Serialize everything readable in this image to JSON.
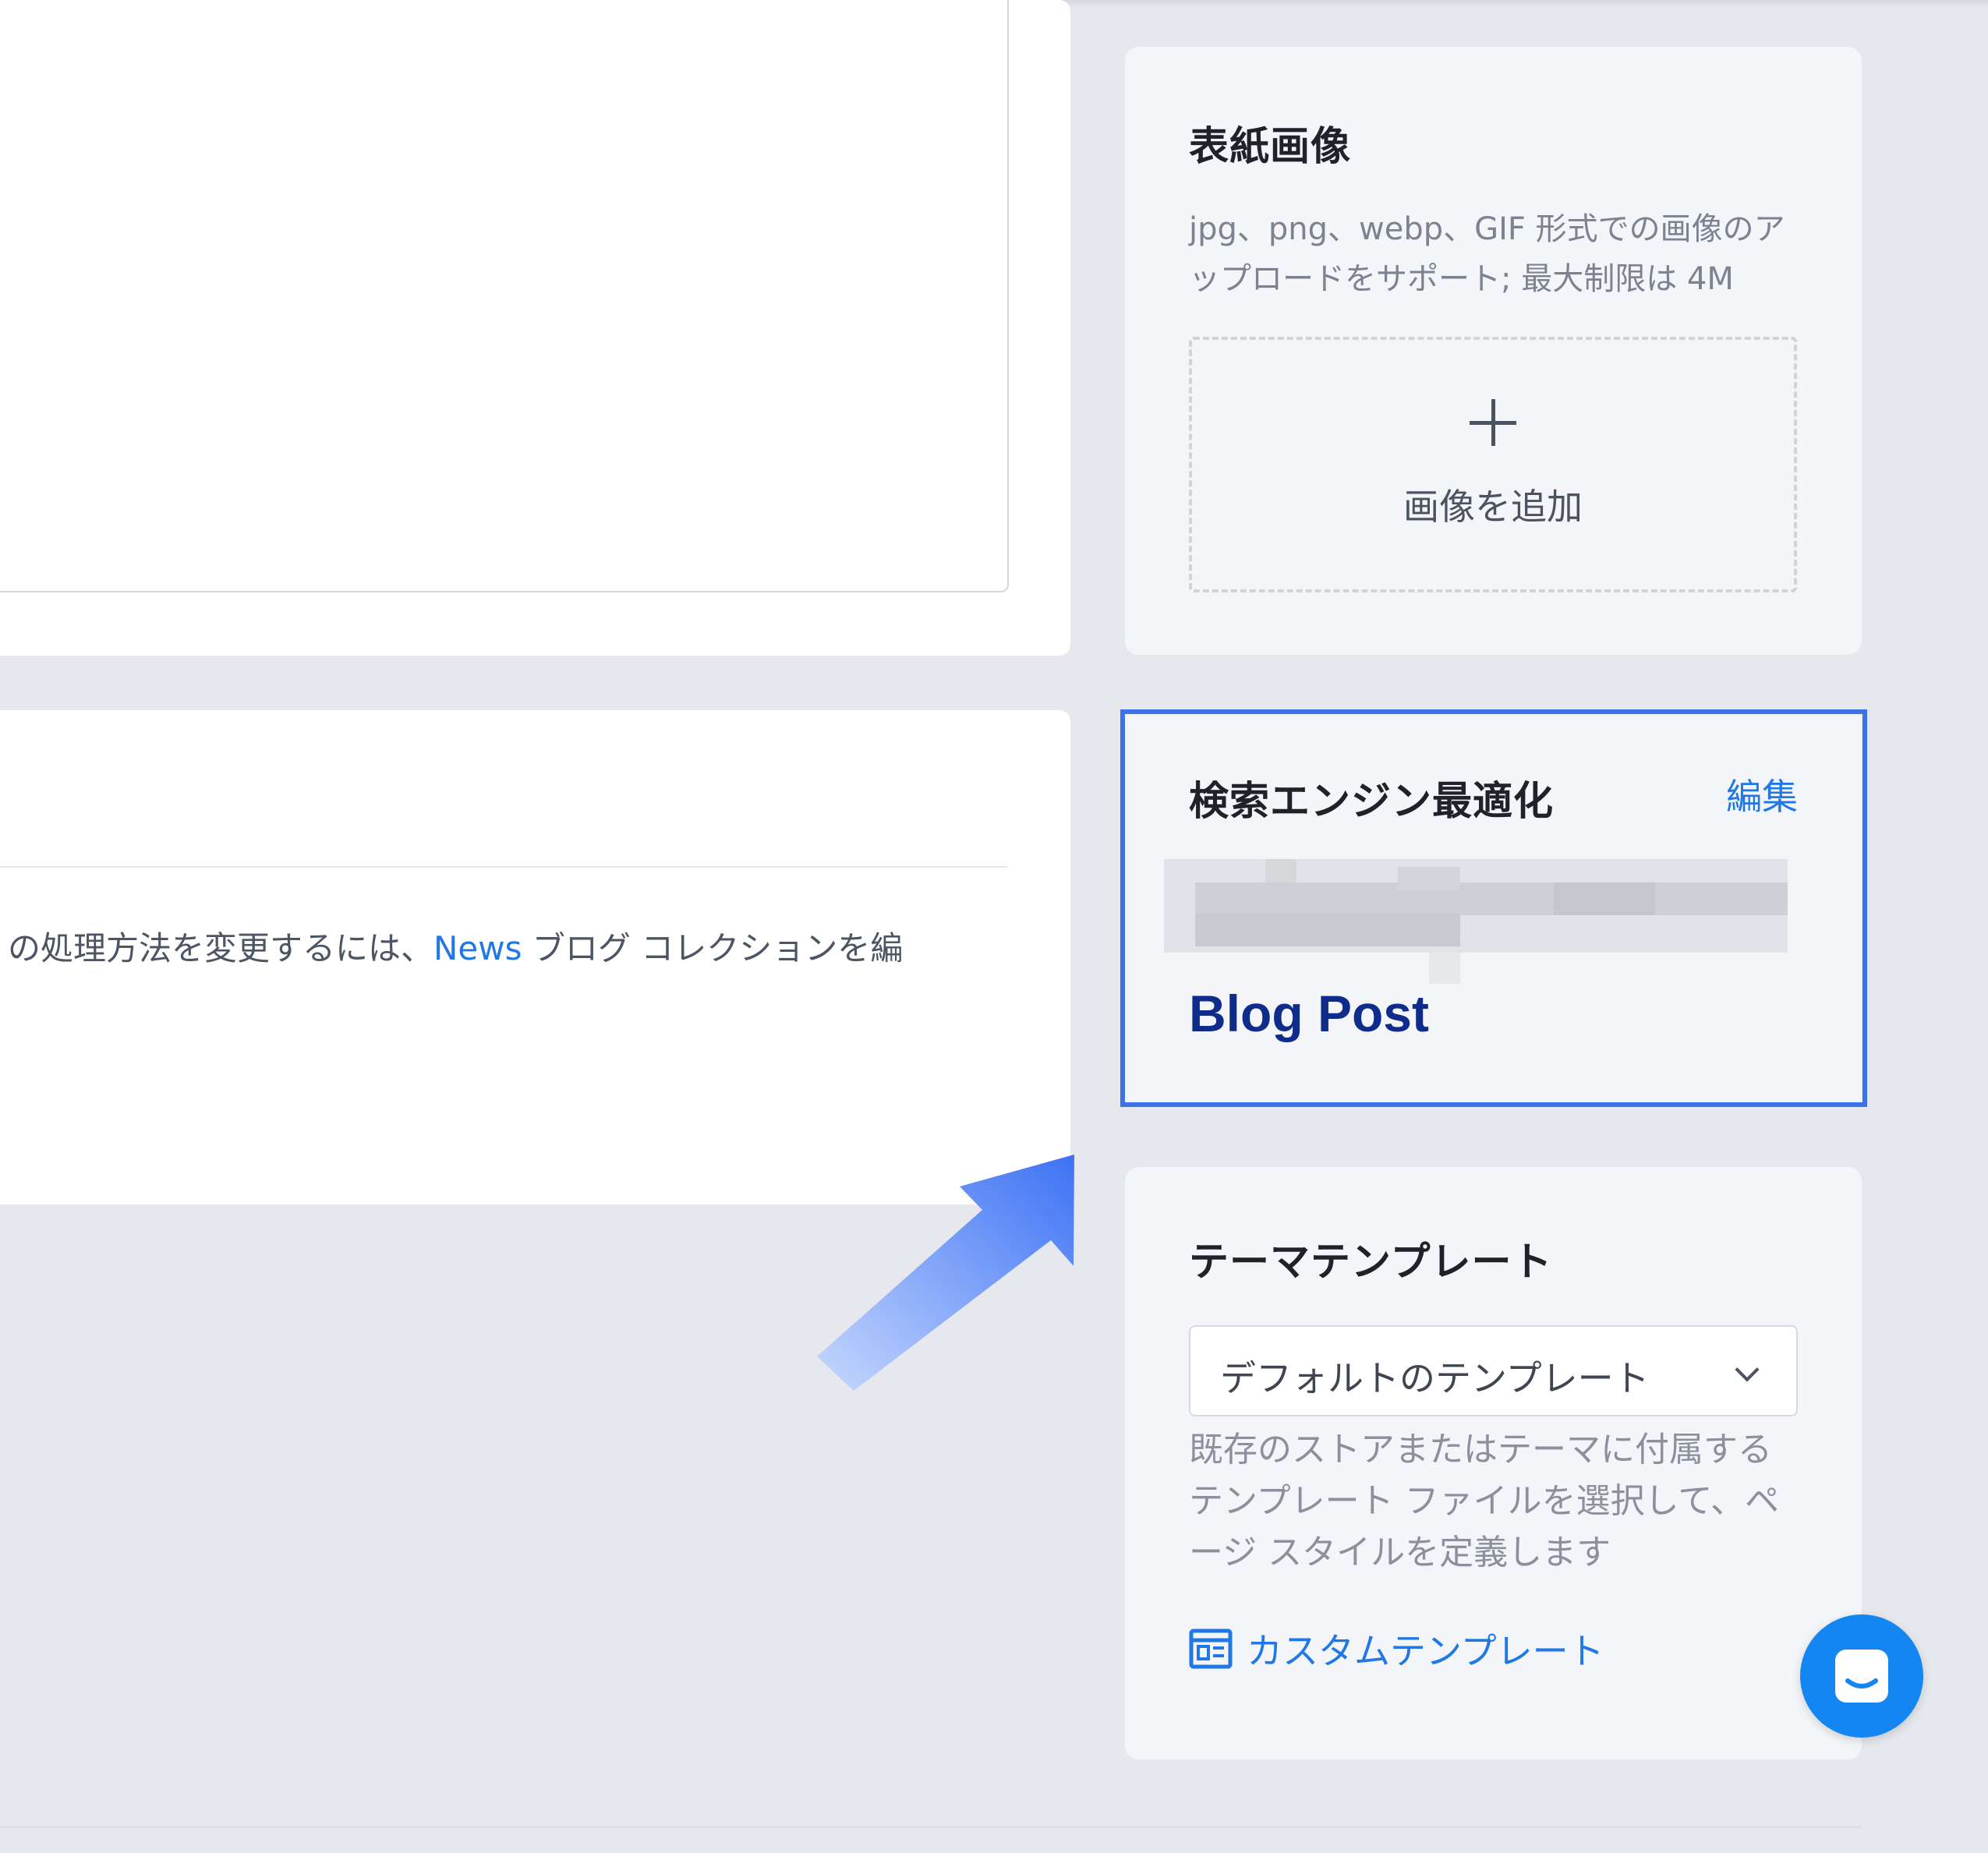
{
  "main": {
    "note_text_before": "の処理方法を変更するには、",
    "note_link": "News",
    "note_text_after": " ブログ コレクションを編"
  },
  "cover_image": {
    "title": "表紙画像",
    "description": "jpg、png、webp、GIF 形式での画像のアップロードをサポート; 最大制限は 4M",
    "add_label": "画像を追加",
    "icon": "plus-icon"
  },
  "seo": {
    "title": "検索エンジン最適化",
    "edit_label": "編集",
    "page_title": "Blog Post"
  },
  "theme_template": {
    "title": "テーマテンプレート",
    "selected": "デフォルトのテンプレート",
    "description": "既存のストアまたはテーマに付属するテンプレート ファイルを選択して、ページ スタイルを定義します",
    "custom_link": "カスタムテンプレート",
    "icon": "template-icon"
  },
  "chat": {
    "icon": "chat-icon"
  },
  "colors": {
    "accent": "#1f78e6",
    "highlight_frame": "#3a73ea",
    "seo_title": "#0f2c8a",
    "chat_button": "#1486f2"
  }
}
